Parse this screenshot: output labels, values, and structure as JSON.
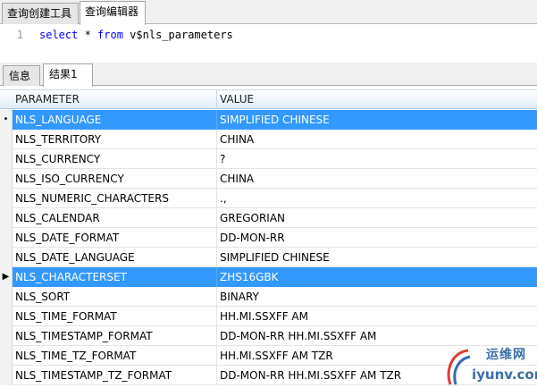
{
  "top_tabs": [
    {
      "label": "查询创建工具"
    },
    {
      "label": "查询编辑器"
    }
  ],
  "editor": {
    "line_number": "1",
    "code": {
      "kw1": "select",
      "star": " * ",
      "kw2": "from",
      "table": " v$nls_parameters"
    }
  },
  "result_tabs": [
    {
      "label": "信息"
    },
    {
      "label": "结果1"
    }
  ],
  "grid": {
    "columns": [
      "PARAMETER",
      "VALUE"
    ],
    "rows": [
      {
        "indicator": "•",
        "parameter": "NLS_LANGUAGE",
        "value": "SIMPLIFIED CHINESE",
        "selected": true
      },
      {
        "indicator": "",
        "parameter": "NLS_TERRITORY",
        "value": "CHINA",
        "selected": false
      },
      {
        "indicator": "",
        "parameter": "NLS_CURRENCY",
        "value": "?",
        "selected": false
      },
      {
        "indicator": "",
        "parameter": "NLS_ISO_CURRENCY",
        "value": "CHINA",
        "selected": false
      },
      {
        "indicator": "",
        "parameter": "NLS_NUMERIC_CHARACTERS",
        "value": ".,",
        "selected": false
      },
      {
        "indicator": "",
        "parameter": "NLS_CALENDAR",
        "value": "GREGORIAN",
        "selected": false
      },
      {
        "indicator": "",
        "parameter": "NLS_DATE_FORMAT",
        "value": "DD-MON-RR",
        "selected": false
      },
      {
        "indicator": "",
        "parameter": "NLS_DATE_LANGUAGE",
        "value": "SIMPLIFIED CHINESE",
        "selected": false
      },
      {
        "indicator": "▶",
        "parameter": "NLS_CHARACTERSET",
        "value": "ZHS16GBK",
        "selected": true
      },
      {
        "indicator": "",
        "parameter": "NLS_SORT",
        "value": "BINARY",
        "selected": false
      },
      {
        "indicator": "",
        "parameter": "NLS_TIME_FORMAT",
        "value": "HH.MI.SSXFF AM",
        "selected": false
      },
      {
        "indicator": "",
        "parameter": "NLS_TIMESTAMP_FORMAT",
        "value": "DD-MON-RR HH.MI.SSXFF AM",
        "selected": false
      },
      {
        "indicator": "",
        "parameter": "NLS_TIME_TZ_FORMAT",
        "value": "HH.MI.SSXFF AM TZR",
        "selected": false
      },
      {
        "indicator": "",
        "parameter": "NLS_TIMESTAMP_TZ_FORMAT",
        "value": "DD-MON-RR HH.MI.SSXFF AM TZR",
        "selected": false
      }
    ]
  },
  "watermark": {
    "name": "运维网",
    "url": "iyunv.com"
  },
  "colors": {
    "selection": "#3399ff",
    "keyword": "#0000ff",
    "header_gradient_end": "#dfeefa"
  }
}
